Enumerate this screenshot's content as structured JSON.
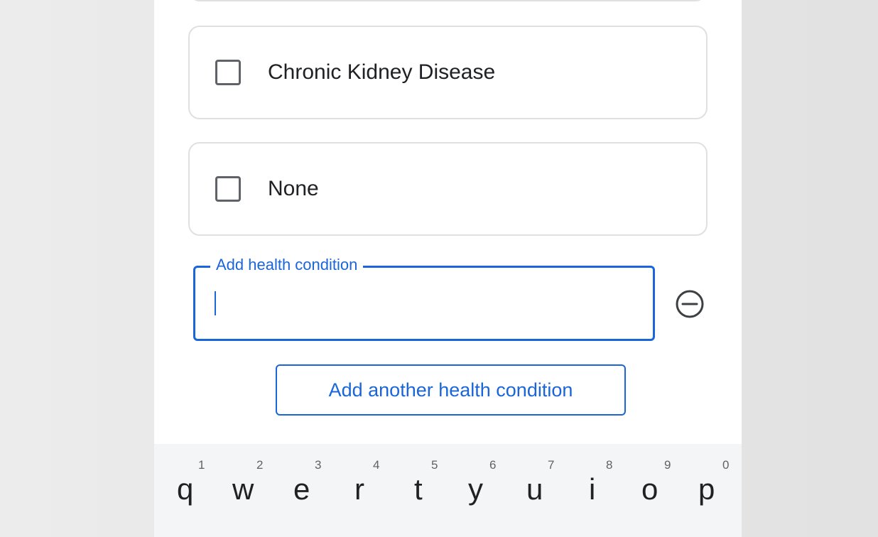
{
  "options": [
    {
      "label": "Chronic Kidney Disease",
      "checked": false
    },
    {
      "label": "None",
      "checked": false
    }
  ],
  "health_field": {
    "legend": "Add health condition",
    "value": "",
    "placeholder": ""
  },
  "add_button": {
    "label": "Add another health condition"
  },
  "keyboard": {
    "keys": [
      {
        "char": "q",
        "hint": "1"
      },
      {
        "char": "w",
        "hint": "2"
      },
      {
        "char": "e",
        "hint": "3"
      },
      {
        "char": "r",
        "hint": "4"
      },
      {
        "char": "t",
        "hint": "5"
      },
      {
        "char": "y",
        "hint": "6"
      },
      {
        "char": "u",
        "hint": "7"
      },
      {
        "char": "i",
        "hint": "8"
      },
      {
        "char": "o",
        "hint": "9"
      },
      {
        "char": "p",
        "hint": "0"
      }
    ]
  },
  "colors": {
    "accent": "#1a66d8",
    "border": "#e0e0e0",
    "keyboard_bg": "#f3f5f7"
  },
  "icons": {
    "remove": "minus-circle-icon"
  }
}
